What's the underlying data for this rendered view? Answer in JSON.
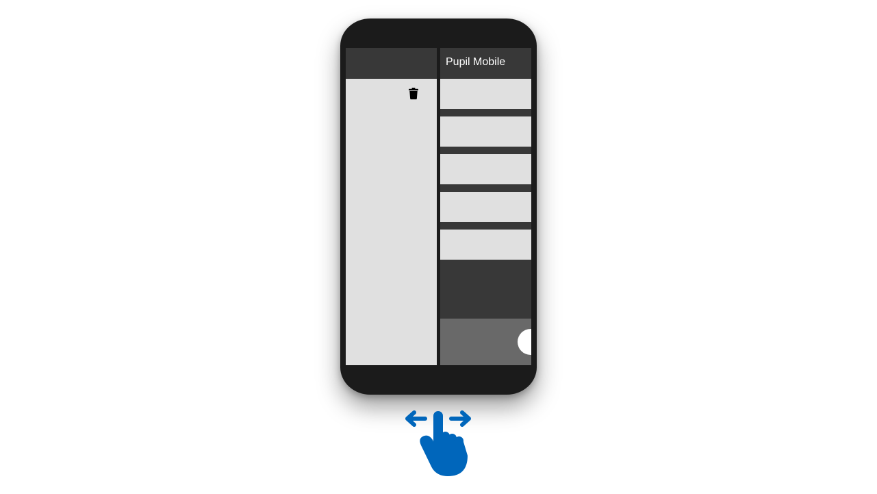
{
  "app": {
    "title": "Pupil Mobile"
  },
  "left_panel": {
    "delete_icon": "trash-icon"
  },
  "list": {
    "item_count": 5
  },
  "fab": {
    "icon": "circle"
  },
  "gesture": {
    "icon": "swipe-horizontal-hand-icon",
    "arrows": [
      "arrow-left-icon",
      "arrow-right-icon"
    ]
  },
  "colors": {
    "page_background": "#ffffff",
    "phone_body": "#1b1b1b",
    "app_bar": "#383838",
    "list_item": "#e0e0e0",
    "bottom_bar": "#696969",
    "fab": "#ffffff",
    "gesture_accent": "#0066bb"
  }
}
